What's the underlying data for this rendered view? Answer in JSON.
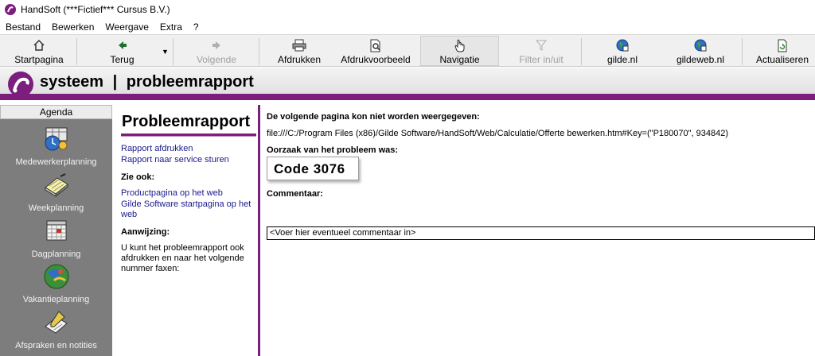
{
  "window": {
    "title": "HandSoft (***Fictief*** Cursus B.V.)"
  },
  "menu": [
    "Bestand",
    "Bewerken",
    "Weergave",
    "Extra",
    "?"
  ],
  "toolbar": {
    "home": "Startpagina",
    "back": "Terug",
    "forward": "Volgende",
    "print": "Afdrukken",
    "preview": "Afdrukvoorbeeld",
    "navigation": "Navigatie",
    "filter": "Filter in/uit",
    "gilde": "gilde.nl",
    "gildeweb": "gildeweb.nl",
    "refresh": "Actualiseren"
  },
  "header": {
    "module": "systeem",
    "separator": "|",
    "page": "probleemrapport"
  },
  "sidebar": {
    "header": "Agenda",
    "items": [
      "Medewerkerplanning",
      "Weekplanning",
      "Dagplanning",
      "Vakantieplanning",
      "Afspraken en notities"
    ]
  },
  "nav": {
    "title": "Probleemrapport",
    "links": [
      "Rapport afdrukken",
      "Rapport naar service sturen"
    ],
    "see_also_label": "Zie ook:",
    "see_also": [
      "Productpagina op het web",
      "Gilde Software startpagina op het web"
    ],
    "hint_label": "Aanwijzing:",
    "hint_text": "U kunt het probleemrapport ook afdrukken en naar het volgende nummer faxen:"
  },
  "main": {
    "intro": "De volgende pagina kon niet worden weergegeven:",
    "path": "file:///C:/Program Files (x86)/Gilde Software/HandSoft/Web/Calculatie/Offerte bewerken.htm#Key=(\"P180070\", 934842)",
    "cause_label": "Oorzaak van het probleem was:",
    "code": "Code 3076",
    "comment_label": "Commentaar:",
    "comment_value": "<Voer hier eventueel commentaar in>"
  },
  "colors": {
    "accent": "#7b1e7e",
    "sidebar_bg": "#7d7d7d",
    "link": "#1a1a8e"
  }
}
